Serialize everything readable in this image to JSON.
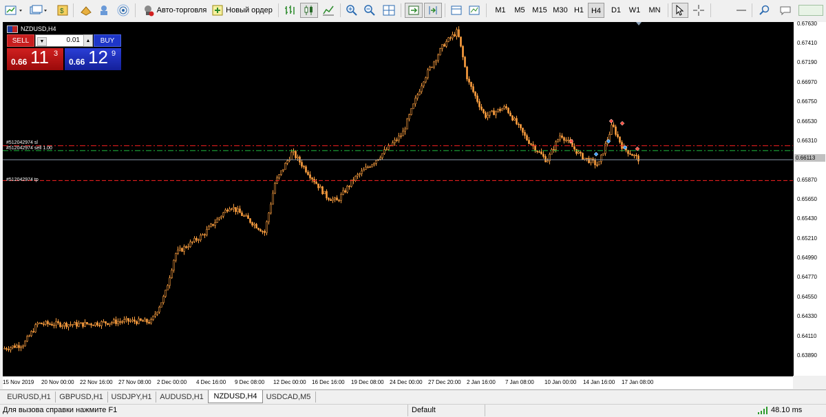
{
  "toolbar": {
    "auto_trading_label": "Авто-торговля",
    "new_order_label": "Новый ордер",
    "timeframes": [
      "M1",
      "M5",
      "M15",
      "M30",
      "H1",
      "H4",
      "D1",
      "W1",
      "MN"
    ],
    "active_timeframe": "H4"
  },
  "chart": {
    "symbol_label": "NZDUSD,H4",
    "trade_panel": {
      "sell_label": "SELL",
      "buy_label": "BUY",
      "volume": "0.01",
      "sell_big": "0.66",
      "sell_digits": "11",
      "sell_sup": "3",
      "buy_big": "0.66",
      "buy_digits": "12",
      "buy_sup": "9"
    },
    "levels": [
      {
        "label": "#512042974 sl",
        "price": 0.6627,
        "color": "#ff2020",
        "style": "dash-dot"
      },
      {
        "label": "#512042974 sell 1.00",
        "price": 0.66215,
        "color": "#20c040",
        "style": "dash-dot"
      },
      {
        "label": "#512042974 tp",
        "price": 0.6588,
        "color": "#ff2020",
        "style": "dash"
      }
    ],
    "current_price": "0.66113",
    "current_price_value": 0.66113,
    "price_axis": [
      "0.67630",
      "0.67410",
      "0.67190",
      "0.66970",
      "0.66750",
      "0.66530",
      "0.66310",
      "0.66090",
      "0.65870",
      "0.65650",
      "0.65430",
      "0.65210",
      "0.64990",
      "0.64770",
      "0.64550",
      "0.64330",
      "0.64110",
      "0.63890"
    ],
    "time_axis": [
      "15 Nov 2019",
      "20 Nov 00:00",
      "22 Nov 16:00",
      "27 Nov 08:00",
      "2 Dec 00:00",
      "4 Dec 16:00",
      "9 Dec 08:00",
      "12 Dec 00:00",
      "16 Dec 16:00",
      "19 Dec 08:00",
      "24 Dec 00:00",
      "27 Dec 20:00",
      "2 Jan 16:00",
      "7 Jan 08:00",
      "10 Jan 00:00",
      "14 Jan 16:00",
      "17 Jan 08:00"
    ],
    "candle_color": "#ffa040",
    "background": "#000000"
  },
  "tabs": [
    "EURUSD,H1",
    "GBPUSD,H1",
    "USDJPY,H1",
    "AUDUSD,H1",
    "NZDUSD,H4",
    "USDCAD,M5"
  ],
  "active_tab": "NZDUSD,H4",
  "status": {
    "help": "Для вызова справки нажмите F1",
    "profile": "Default",
    "ping": "48.10 ms"
  }
}
